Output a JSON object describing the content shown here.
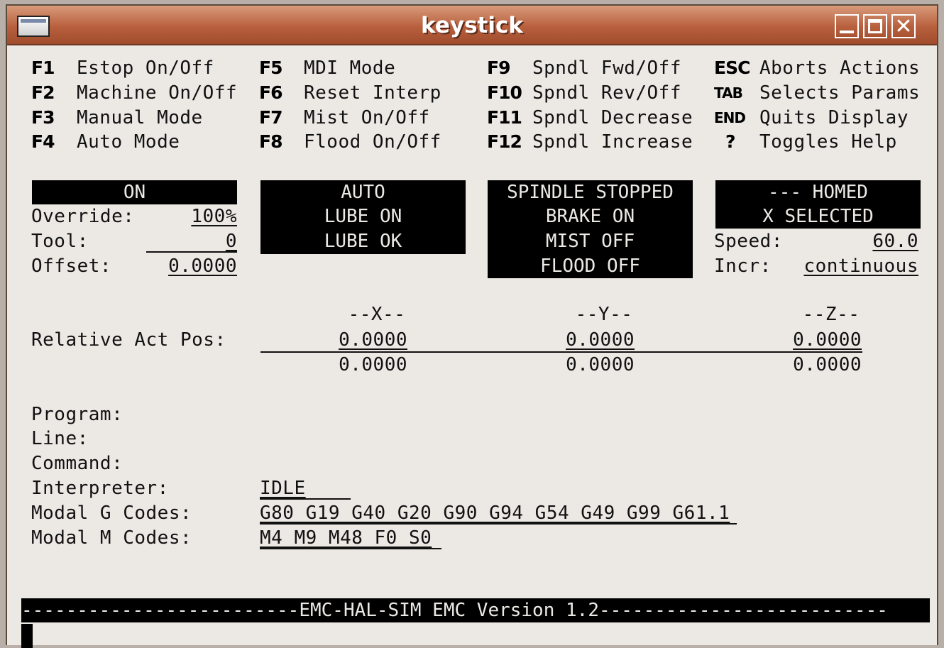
{
  "window": {
    "title": "keystick"
  },
  "keys": [
    {
      "key": "F1",
      "label": "Estop On/Off"
    },
    {
      "key": "F2",
      "label": "Machine On/Off"
    },
    {
      "key": "F3",
      "label": "Manual Mode"
    },
    {
      "key": "F4",
      "label": "Auto Mode"
    },
    {
      "key": "F5",
      "label": "MDI Mode"
    },
    {
      "key": "F6",
      "label": "Reset Interp"
    },
    {
      "key": "F7",
      "label": "Mist On/Off"
    },
    {
      "key": "F8",
      "label": "Flood On/Off"
    },
    {
      "key": "F9",
      "label": "Spndl Fwd/Off"
    },
    {
      "key": "F10",
      "label": "Spndl Rev/Off"
    },
    {
      "key": "F11",
      "label": "Spndl Decrease"
    },
    {
      "key": "F12",
      "label": "Spndl Increase"
    },
    {
      "key": "ESC",
      "label": "Aborts Actions"
    },
    {
      "key": "TAB",
      "label": "Selects Params"
    },
    {
      "key": "END",
      "label": "Quits Display"
    },
    {
      "key": "?",
      "label": "Toggles Help"
    }
  ],
  "status": {
    "machine": "ON",
    "override_label": "Override:",
    "override_value": "100%",
    "tool_label": "Tool:",
    "tool_value": "0",
    "offset_label": "Offset:",
    "offset_value": "0.0000",
    "mode": "AUTO",
    "lube": "LUBE ON",
    "lube_ok": "LUBE OK",
    "spindle": "SPINDLE STOPPED",
    "brake": "BRAKE ON",
    "mist": "MIST OFF",
    "flood": "FLOOD OFF",
    "homed": "--- HOMED",
    "axis_selected": "X SELECTED",
    "speed_label": "Speed:",
    "speed_value": "60.0",
    "incr_label": "Incr:",
    "incr_value": "continuous"
  },
  "position": {
    "label": "Relative Act Pos:",
    "axes": [
      "--X--",
      "--Y--",
      "--Z--"
    ],
    "actual": [
      "0.0000",
      "0.0000",
      "0.0000"
    ],
    "second": [
      "0.0000",
      "0.0000",
      "0.0000"
    ]
  },
  "program": {
    "program_label": "Program:",
    "line_label": "Line:",
    "command_label": "Command:",
    "interp_label": "Interpreter:",
    "interp_value": "IDLE",
    "gcodes_label": "Modal G Codes:",
    "gcodes_value": "G80 G19 G40 G20 G90 G94 G54 G49 G99 G61.1",
    "mcodes_label": "Modal M Codes:",
    "mcodes_value": "M4 M9 M48 F0 S0"
  },
  "footer": {
    "status_line": "-------------------------EMC-HAL-SIM EMC Version 1.2--------------------------"
  }
}
